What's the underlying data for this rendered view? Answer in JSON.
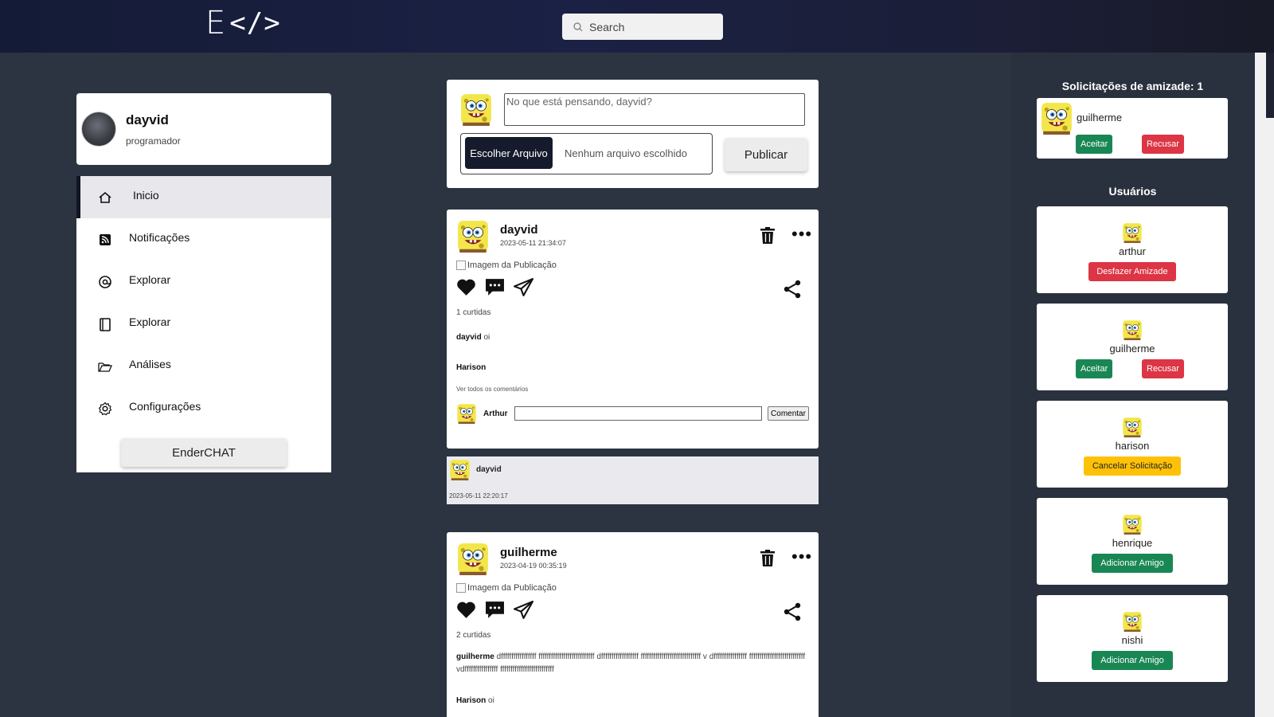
{
  "header": {
    "logo_mark": "E",
    "logo_code": "</>",
    "search_placeholder": "Search"
  },
  "profile": {
    "name": "dayvid",
    "role": "programador"
  },
  "nav": {
    "items": [
      {
        "label": "Inicio",
        "icon": "home-icon"
      },
      {
        "label": "Notificações",
        "icon": "rss-icon"
      },
      {
        "label": "Explorar",
        "icon": "at-icon"
      },
      {
        "label": "Explorar",
        "icon": "book-icon"
      },
      {
        "label": "Análises",
        "icon": "folder-icon"
      },
      {
        "label": "Configurações",
        "icon": "gear-icon"
      }
    ],
    "enderchat_label": "EnderCHAT"
  },
  "composer": {
    "placeholder": "No que está pensando, dayvid?",
    "file_button": "Escolher Arquivo",
    "file_status": "Nenhum arquivo escolhido",
    "publish_label": "Publicar"
  },
  "posts": [
    {
      "author": "dayvid",
      "date": "2023-05-11 21:34:07",
      "image_alt": "Imagem da Publicação",
      "likes": "1 curtidas",
      "caption_author": "dayvid",
      "caption_text": " oi",
      "comments": [
        {
          "author": "Harison",
          "text": ""
        }
      ],
      "view_all": "Ver todos os comentários",
      "commenter": "Arthur",
      "comment_button": "Comentar"
    },
    {
      "author": "guilherme",
      "date": "2023-04-19 00:35:19",
      "image_alt": "Imagem da Publicação",
      "likes": "2 curtidas",
      "caption_author": "guilherme",
      "caption_text": " dfffffffffffffffff fffffffffffffffffffffffffff dffffffffffffffffff fffffffffffffffffffffffffffff v dffffffffffffffff fffffffffffffffffffffffffff vdffffffffffffffff ffffffffffffffffffffffffff",
      "comments": [
        {
          "author": "Harison",
          "text": " oi"
        }
      ]
    }
  ],
  "repost": {
    "author": "dayvid",
    "date": "2023-05-11 22:20:17"
  },
  "friend_requests": {
    "title": "Solicitações de amizade: 1",
    "items": [
      {
        "name": "guilherme",
        "accept": "Aceitar",
        "reject": "Recusar"
      }
    ]
  },
  "users": {
    "title": "Usuários",
    "items": [
      {
        "name": "arthur",
        "action": "Desfazer Amizade"
      },
      {
        "name": "guilherme",
        "accept": "Aceitar",
        "reject": "Recusar"
      },
      {
        "name": "harison",
        "action": "Cancelar Solicitação"
      },
      {
        "name": "henrique",
        "action": "Adicionar Amigo"
      },
      {
        "name": "nishi",
        "action": "Adicionar Amigo"
      }
    ]
  },
  "colors": {
    "header_bg": "#1b2144",
    "page_bg": "#2c3442",
    "green": "#198754",
    "red": "#dc3545",
    "yellow": "#ffc107",
    "dark_button": "#151a2c"
  }
}
